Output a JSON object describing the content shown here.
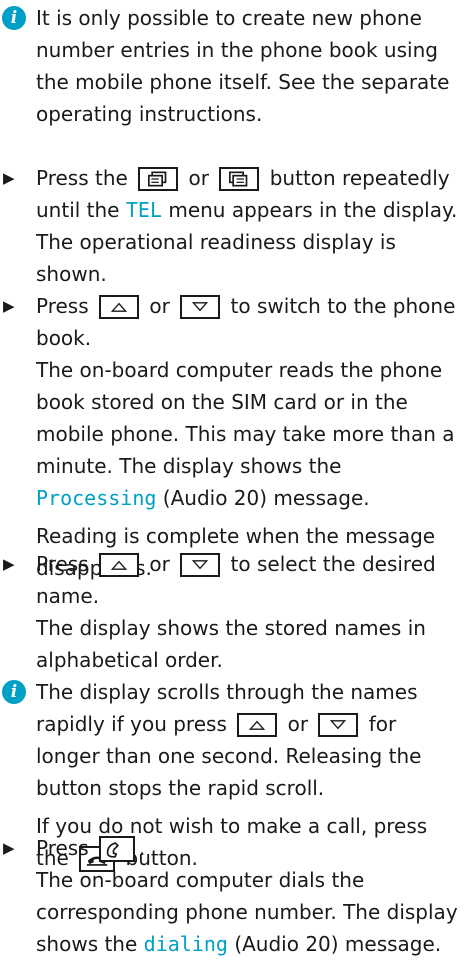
{
  "note1": "It is only possible to create new phone number entries in the phone book using the mobile phone itself. See the separate operating instructions.",
  "step1": {
    "pre": "Press the",
    "mid": "or",
    "post": "button repeatedly until the",
    "menu": "TEL",
    "post2": "menu appears in the display.",
    "result": "The operational readiness display is shown."
  },
  "step2": {
    "pre": "Press",
    "mid": "or",
    "post": "to switch to the phone book.",
    "result_pre": "The on-board computer reads the phone book stored on the SIM card or in the mobile phone. This may take more than a minute. The display shows the",
    "msg": "Processing",
    "result_post": "(Audio 20) message.",
    "result2": "Reading is complete when the message disappears."
  },
  "step3": {
    "pre": "Press",
    "mid": "or",
    "post": "to select the desired name.",
    "result": "The display shows the stored names in alphabetical order."
  },
  "note2": {
    "pre": "The display scrolls through the names rapidly if you press",
    "mid": "or",
    "post": "for longer than one second. Releasing the button stops the rapid scroll.",
    "p2_pre": "If you do not wish to make a call, press the",
    "p2_post": "button."
  },
  "step4": {
    "pre": "Press",
    "post": ".",
    "result_pre": "The on-board computer dials the corresponding phone number. The display shows the",
    "msg": "dialing",
    "result_post": "(Audio 20) message."
  },
  "colors": {
    "accent": "#00a0c6",
    "text": "#1a1a1a"
  }
}
